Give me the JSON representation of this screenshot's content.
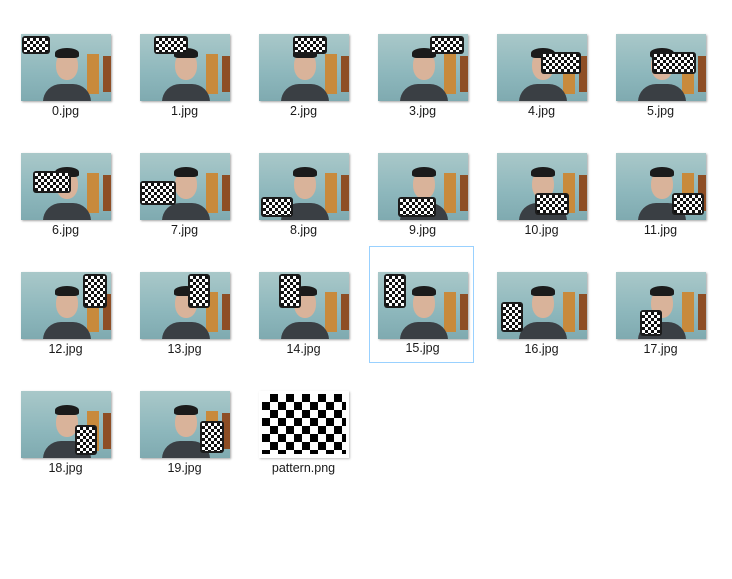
{
  "files": [
    {
      "name": "0.jpg"
    },
    {
      "name": "1.jpg"
    },
    {
      "name": "2.jpg"
    },
    {
      "name": "3.jpg"
    },
    {
      "name": "4.jpg"
    },
    {
      "name": "5.jpg"
    },
    {
      "name": "6.jpg"
    },
    {
      "name": "7.jpg"
    },
    {
      "name": "8.jpg"
    },
    {
      "name": "9.jpg"
    },
    {
      "name": "10.jpg"
    },
    {
      "name": "11.jpg"
    },
    {
      "name": "12.jpg"
    },
    {
      "name": "13.jpg"
    },
    {
      "name": "14.jpg"
    },
    {
      "name": "15.jpg",
      "selected": true
    },
    {
      "name": "16.jpg"
    },
    {
      "name": "17.jpg"
    },
    {
      "name": "18.jpg"
    },
    {
      "name": "19.jpg"
    },
    {
      "name": "pattern.png",
      "kind": "pattern"
    }
  ],
  "colors": {
    "selection_border": "#99d1ff",
    "label_text": "#1a1a1a",
    "background": "#ffffff"
  }
}
